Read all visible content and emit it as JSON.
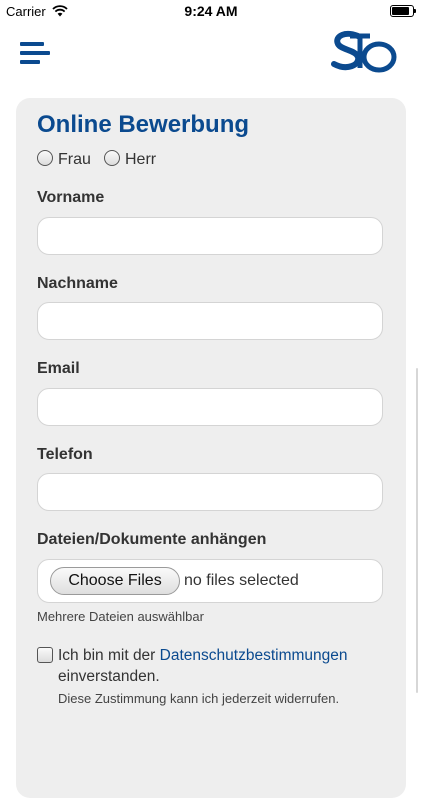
{
  "status_bar": {
    "carrier": "Carrier",
    "time": "9:24 AM"
  },
  "header": {
    "menu_icon": "hamburger-menu-icon",
    "logo": "sto-logo"
  },
  "colors": {
    "brand": "#0b4a8f",
    "card_background": "#eeeeee"
  },
  "form": {
    "title": "Online Bewerbung",
    "salutation_options": [
      "Frau",
      "Herr"
    ],
    "fields": [
      {
        "label": "Vorname",
        "value": "",
        "placeholder": ""
      },
      {
        "label": "Nachname",
        "value": "",
        "placeholder": ""
      },
      {
        "label": "Email",
        "value": "",
        "placeholder": ""
      },
      {
        "label": "Telefon",
        "value": "",
        "placeholder": ""
      }
    ],
    "attachments": {
      "label": "Dateien/Dokumente anhängen",
      "button": "Choose Files",
      "status": "no files selected",
      "hint": "Mehrere Dateien auswählbar"
    },
    "consent": {
      "text_before": "Ich bin mit der",
      "link": "Datenschutzbestimmungen",
      "text_after": "einverstanden.",
      "note": "Diese Zustimmung kann ich jederzeit widerrufen."
    }
  }
}
